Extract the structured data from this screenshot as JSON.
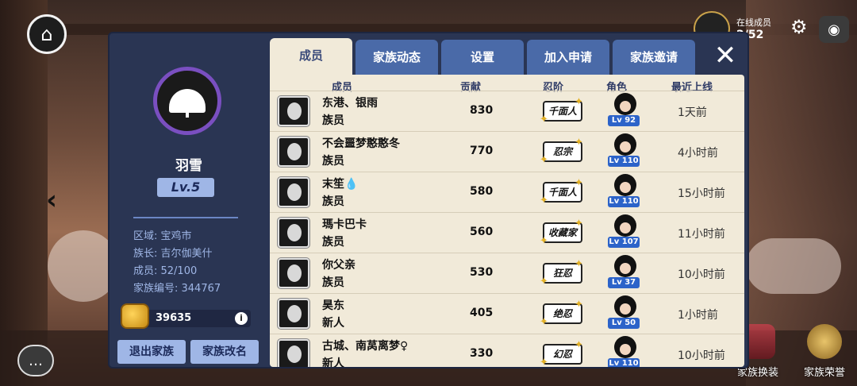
{
  "online": {
    "label": "在线成员",
    "count": "2/52"
  },
  "icons": {
    "home": "house-icon",
    "back": "chevron-left-icon",
    "chat": "chat-bubble-icon",
    "settings": "gear-icon",
    "view": "eye-icon",
    "close": "close-icon",
    "gold": "gold-coin-bag-icon",
    "info": "info-icon"
  },
  "bottom_buttons": {
    "outfit": "家族换装",
    "honor": "家族荣誉"
  },
  "clan": {
    "name": "羽雪",
    "level": "Lv.5",
    "region": "区域: 宝鸡市",
    "leader": "族长: 吉尔伽美什",
    "members": "成员: 52/100",
    "clan_id": "家族编号: 344767",
    "gold": "39635",
    "leave_button": "退出家族",
    "rename_button": "家族改名"
  },
  "tabs": [
    "成员",
    "家族动态",
    "设置",
    "加入申请",
    "家族邀请"
  ],
  "active_tab": 0,
  "table": {
    "headers": {
      "member": "成员",
      "contribution": "贡献",
      "rank": "忍阶",
      "role": "角色",
      "last_online": "最近上线"
    },
    "rows": [
      {
        "name": "东港、银雨",
        "title": "族员",
        "contribution": "830",
        "rank": "千面人",
        "level": "Lv 92",
        "last_online": "1天前"
      },
      {
        "name": "不会噩梦憨憨冬",
        "title": "族员",
        "contribution": "770",
        "rank": "忍宗",
        "level": "Lv 110",
        "last_online": "4小时前"
      },
      {
        "name": "末笙💧",
        "title": "族员",
        "contribution": "580",
        "rank": "千面人",
        "level": "Lv 110",
        "last_online": "15小时前"
      },
      {
        "name": "瑪卡巴卡",
        "title": "族员",
        "contribution": "560",
        "rank": "收藏家",
        "level": "Lv 107",
        "last_online": "11小时前"
      },
      {
        "name": "你父亲",
        "title": "族员",
        "contribution": "530",
        "rank": "狂忍",
        "level": "Lv 37",
        "last_online": "10小时前"
      },
      {
        "name": "昊东",
        "title": "新人",
        "contribution": "405",
        "rank": "绝忍",
        "level": "Lv 50",
        "last_online": "1小时前"
      },
      {
        "name": "古城、南莴离梦♀",
        "title": "新人",
        "contribution": "330",
        "rank": "幻忍",
        "level": "Lv 110",
        "last_online": "10小时前"
      }
    ]
  },
  "colors": {
    "panel": "#2a3553",
    "accent": "#9fb6e6",
    "tab": "#4a6aa8",
    "table_bg": "#f1ead9",
    "level_badge": "#2c63c9",
    "emblem_ring": "#7a4fc0"
  }
}
